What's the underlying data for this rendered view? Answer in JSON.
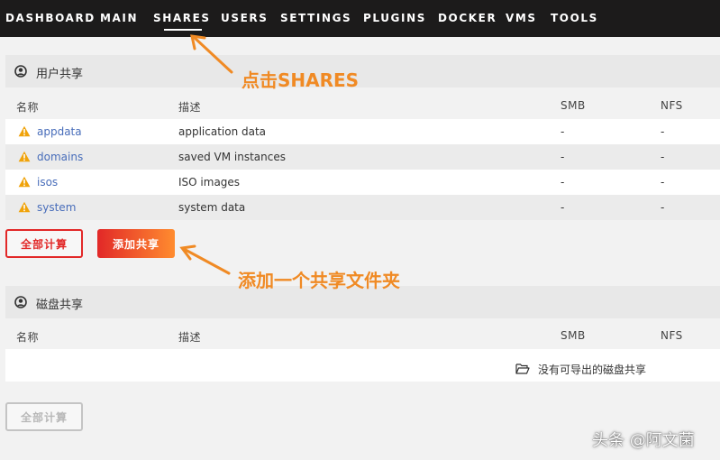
{
  "nav": {
    "items": [
      "DASHBOARD",
      "MAIN",
      "SHARES",
      "USERS",
      "SETTINGS",
      "PLUGINS",
      "DOCKER",
      "VMS",
      "TOOLS"
    ],
    "active": "SHARES"
  },
  "user_shares": {
    "icon": "user-circle-icon",
    "title": "用户共享",
    "columns": [
      "名称",
      "描述",
      "SMB",
      "NFS"
    ],
    "rows": [
      {
        "name": "appdata",
        "desc": "application data",
        "smb": "-",
        "nfs": "-",
        "status_icon": "warning-icon"
      },
      {
        "name": "domains",
        "desc": "saved VM instances",
        "smb": "-",
        "nfs": "-",
        "status_icon": "warning-icon"
      },
      {
        "name": "isos",
        "desc": "ISO images",
        "smb": "-",
        "nfs": "-",
        "status_icon": "warning-icon"
      },
      {
        "name": "system",
        "desc": "system data",
        "smb": "-",
        "nfs": "-",
        "status_icon": "warning-icon"
      }
    ],
    "compute_all_label": "全部计算",
    "add_share_label": "添加共享"
  },
  "disk_shares": {
    "icon": "user-circle-icon",
    "title": "磁盘共享",
    "columns": [
      "名称",
      "描述",
      "SMB",
      "NFS"
    ],
    "empty_text": "没有可导出的磁盘共享",
    "empty_icon": "folder-open-icon",
    "compute_all_label": "全部计算"
  },
  "annotations": {
    "click_shares": "点击SHARES",
    "add_share_folder": "添加一个共享文件夹"
  },
  "watermark": "头条 @阿文菌",
  "colors": {
    "nav_bg": "#1c1b1b",
    "accent_red": "#e22828",
    "accent_orange": "#ff8c2f",
    "annotation": "#f08a24",
    "link": "#486dba",
    "warning": "#f0a30a"
  }
}
